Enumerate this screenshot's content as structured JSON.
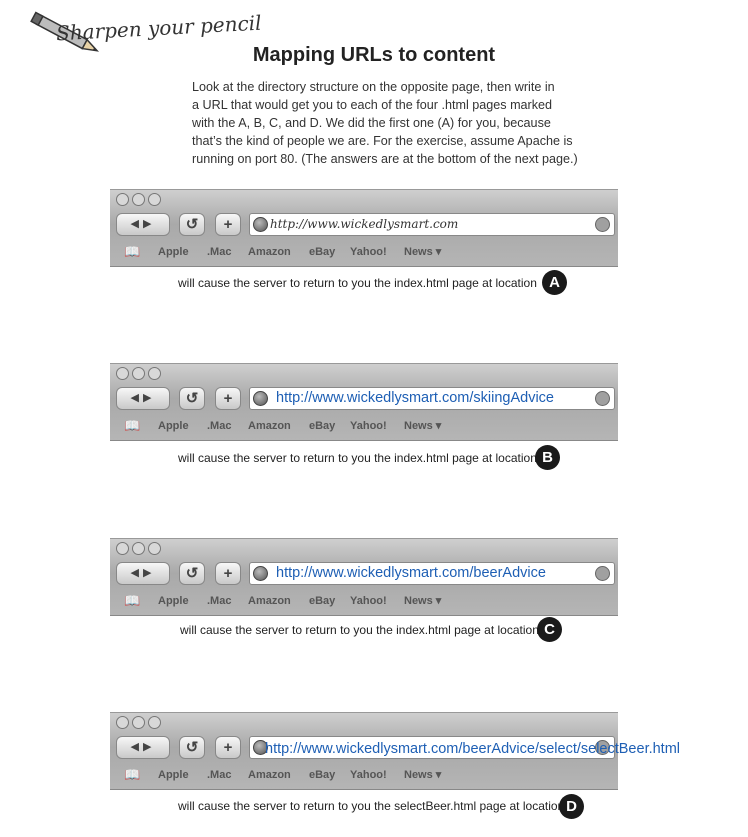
{
  "header": {
    "section_label": "Sharpen your pencil",
    "title": "Mapping URLs to content"
  },
  "instructions": [
    "Look at the directory structure on the opposite page, then write in",
    "a URL that would get you to each of the four .html pages marked",
    "with the A, B, C, and D. We did the first one (A) for you, because",
    "that’s the kind of people we are. For the exercise, assume Apache is",
    "running on port 80. (The answers are at the bottom of the next page.)"
  ],
  "bookmarks": [
    "Apple",
    ".Mac",
    "Amazon",
    "eBay",
    "Yahoo!",
    "News ▾"
  ],
  "exercises": [
    {
      "url": "http://www.wickedlysmart.com",
      "caption": "will cause the server to return to you the index.html page at location",
      "badge": "A"
    },
    {
      "url": "http://www.wickedlysmart.com/skiingAdvice",
      "caption": "will cause the server to return to you the index.html page at location",
      "badge": "B"
    },
    {
      "url": "http://www.wickedlysmart.com/beerAdvice",
      "caption": "will cause the server to return to you the index.html page at location",
      "badge": "C"
    },
    {
      "url": "http://www.wickedlysmart.com/beerAdvice/select/selectBeer.html",
      "caption": "will cause the server to return to you the selectBeer.html page at location",
      "badge": "D"
    }
  ],
  "icons": {
    "pencil": "pencil-icon",
    "globe": "globe-icon",
    "reload": "reload-icon",
    "add": "plus-icon",
    "bookmarks": "book-icon"
  },
  "colors": {
    "url_link": "#1e5fb4",
    "badge": "#1a1a1a"
  }
}
